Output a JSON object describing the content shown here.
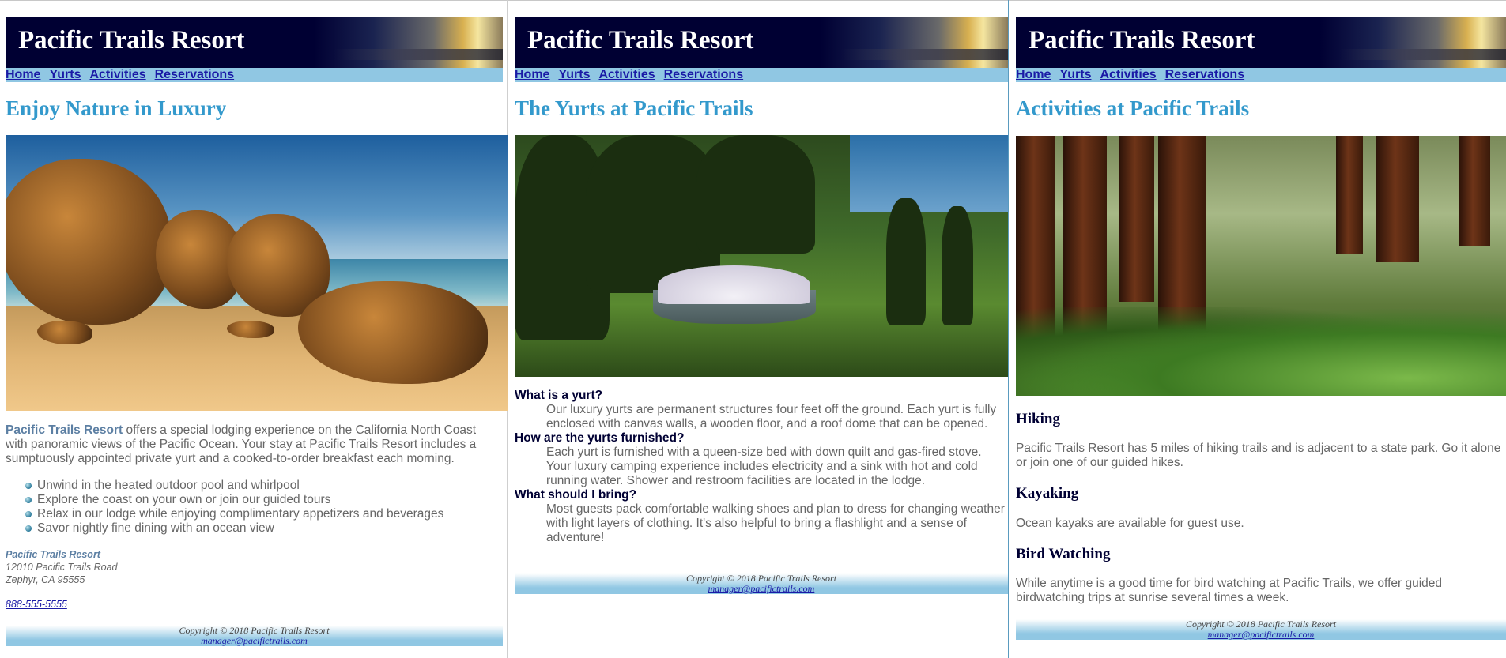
{
  "brand": {
    "title": "Pacific Trails Resort"
  },
  "nav": [
    "Home",
    "Yurts",
    "Activities",
    "Reservations"
  ],
  "footer": {
    "copyright": "Copyright © 2018 Pacific Trails Resort",
    "email": "manager@pacifictrails.com"
  },
  "home": {
    "heading": "Enjoy Nature in Luxury",
    "intro_brand": "Pacific Trails Resort",
    "intro_text": " offers a special lodging experience on the California North Coast with panoramic views of the Pacific Ocean. Your stay at Pacific Trails Resort includes a sumptuously appointed private yurt and a cooked-to-order breakfast each morning.",
    "features": [
      "Unwind in the heated outdoor pool and whirlpool",
      "Explore the coast on your own or join our guided tours",
      "Relax in our lodge while enjoying complimentary appetizers and beverages",
      "Savor nightly fine dining with an ocean view"
    ],
    "address": {
      "name": "Pacific Trails Resort",
      "street": "12010 Pacific Trails Road",
      "city": "Zephyr, CA 95555"
    },
    "phone": "888-555-5555"
  },
  "yurts": {
    "heading": "The Yurts at Pacific Trails",
    "faq": [
      {
        "q": "What is a yurt?",
        "a": "Our luxury yurts are permanent structures four feet off the ground. Each yurt is fully enclosed with canvas walls, a wooden floor, and a roof dome that can be opened."
      },
      {
        "q": "How are the yurts furnished?",
        "a": "Each yurt is furnished with a queen-size bed with down quilt and gas-fired stove. Your luxury camping experience includes electricity and a sink with hot and cold running water. Shower and restroom facilities are located in the lodge."
      },
      {
        "q": "What should I bring?",
        "a": "Most guests pack comfortable walking shoes and plan to dress for changing weather with light layers of clothing. It's also helpful to bring a flashlight and a sense of adventure!"
      }
    ]
  },
  "activities": {
    "heading": "Activities at Pacific Trails",
    "items": [
      {
        "title": "Hiking",
        "text": "Pacific Trails Resort has 5 miles of hiking trails and is adjacent to a state park. Go it alone or join one of our guided hikes."
      },
      {
        "title": "Kayaking",
        "text": "Ocean kayaks are available for guest use."
      },
      {
        "title": "Bird Watching",
        "text": "While anytime is a good time for bird watching at Pacific Trails, we offer guided birdwatching trips at sunrise several times a week."
      }
    ]
  },
  "colors": {
    "banner": "#000033",
    "nav": "#90c7e3",
    "heading": "#3399cc",
    "text": "#666666",
    "link": "#1a1aa6"
  }
}
